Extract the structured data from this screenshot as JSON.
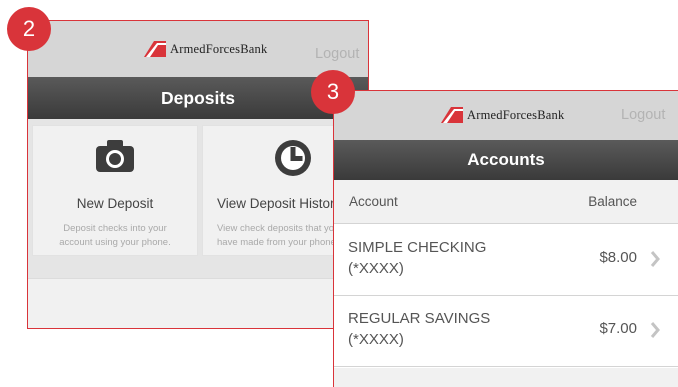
{
  "deposits_screen": {
    "step": "2",
    "brand": "ArmedForcesBank",
    "logout_label": "Logout",
    "title": "Deposits",
    "tiles": [
      {
        "title": "New Deposit",
        "desc_line1": "Deposit checks into your",
        "desc_line2": "account using your phone.",
        "icon": "camera-icon"
      },
      {
        "title": "View Deposit History",
        "desc_line1": "View check deposits that you",
        "desc_line2": "have made from your phone.",
        "icon": "clock-icon"
      }
    ]
  },
  "accounts_screen": {
    "step": "3",
    "brand": "ArmedForcesBank",
    "logout_label": "Logout",
    "title": "Accounts",
    "columns": {
      "account": "Account",
      "balance": "Balance"
    },
    "rows": [
      {
        "name": "SIMPLE CHECKING",
        "number": "(*XXXX)",
        "balance": "$8.00"
      },
      {
        "name": "REGULAR SAVINGS",
        "number": "(*XXXX)",
        "balance": "$7.00"
      }
    ]
  },
  "colors": {
    "accent": "#d9343a",
    "titlebar": "#444444",
    "topbar": "#d6d6d6"
  }
}
